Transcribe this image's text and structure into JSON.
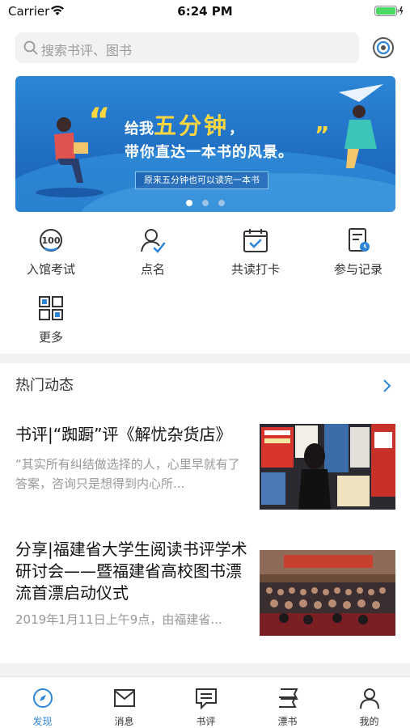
{
  "status_bar": {
    "carrier": "Carrier",
    "time": "6:24 PM"
  },
  "search": {
    "placeholder": "搜索书评、图书"
  },
  "banner": {
    "line1_prefix": "给我",
    "line1_highlight": "五分钟",
    "line1_suffix": "，",
    "line2": "带你直达一本书的风景。",
    "subtitle": "原来五分钟也可以读完一本书",
    "slide_count": 3,
    "active_slide": 1
  },
  "quick_actions": [
    {
      "label": "入馆考试",
      "icon": "exam-100-icon"
    },
    {
      "label": "点名",
      "icon": "roll-call-icon"
    },
    {
      "label": "共读打卡",
      "icon": "calendar-checkin-icon"
    },
    {
      "label": "参与记录",
      "icon": "record-icon"
    },
    {
      "label": "更多",
      "icon": "more-grid-icon"
    }
  ],
  "hot_news": {
    "title": "热门动态",
    "articles": [
      {
        "title": "书评|“踟蹰”评《解忧杂货店》",
        "summary": "“其实所有纠结做选择的人，心里早就有了答案，咨询只是想得到内心所..."
      },
      {
        "title": "分享|福建省大学生阅读书评学术研讨会——暨福建省高校图书漂流首漂启动仪式",
        "summary": "2019年1月11日上午9点，由福建省..."
      }
    ]
  },
  "tabbar": {
    "tabs": [
      {
        "label": "发现",
        "icon": "compass-icon",
        "active": true
      },
      {
        "label": "消息",
        "icon": "message-icon",
        "active": false
      },
      {
        "label": "书评",
        "icon": "review-icon",
        "active": false
      },
      {
        "label": "漂书",
        "icon": "drift-book-icon",
        "active": false
      },
      {
        "label": "我的",
        "icon": "profile-icon",
        "active": false
      }
    ]
  },
  "colors": {
    "accent": "#2f86d8",
    "banner_blue": "#1f6dc2",
    "highlight_yellow": "#ffd640"
  }
}
